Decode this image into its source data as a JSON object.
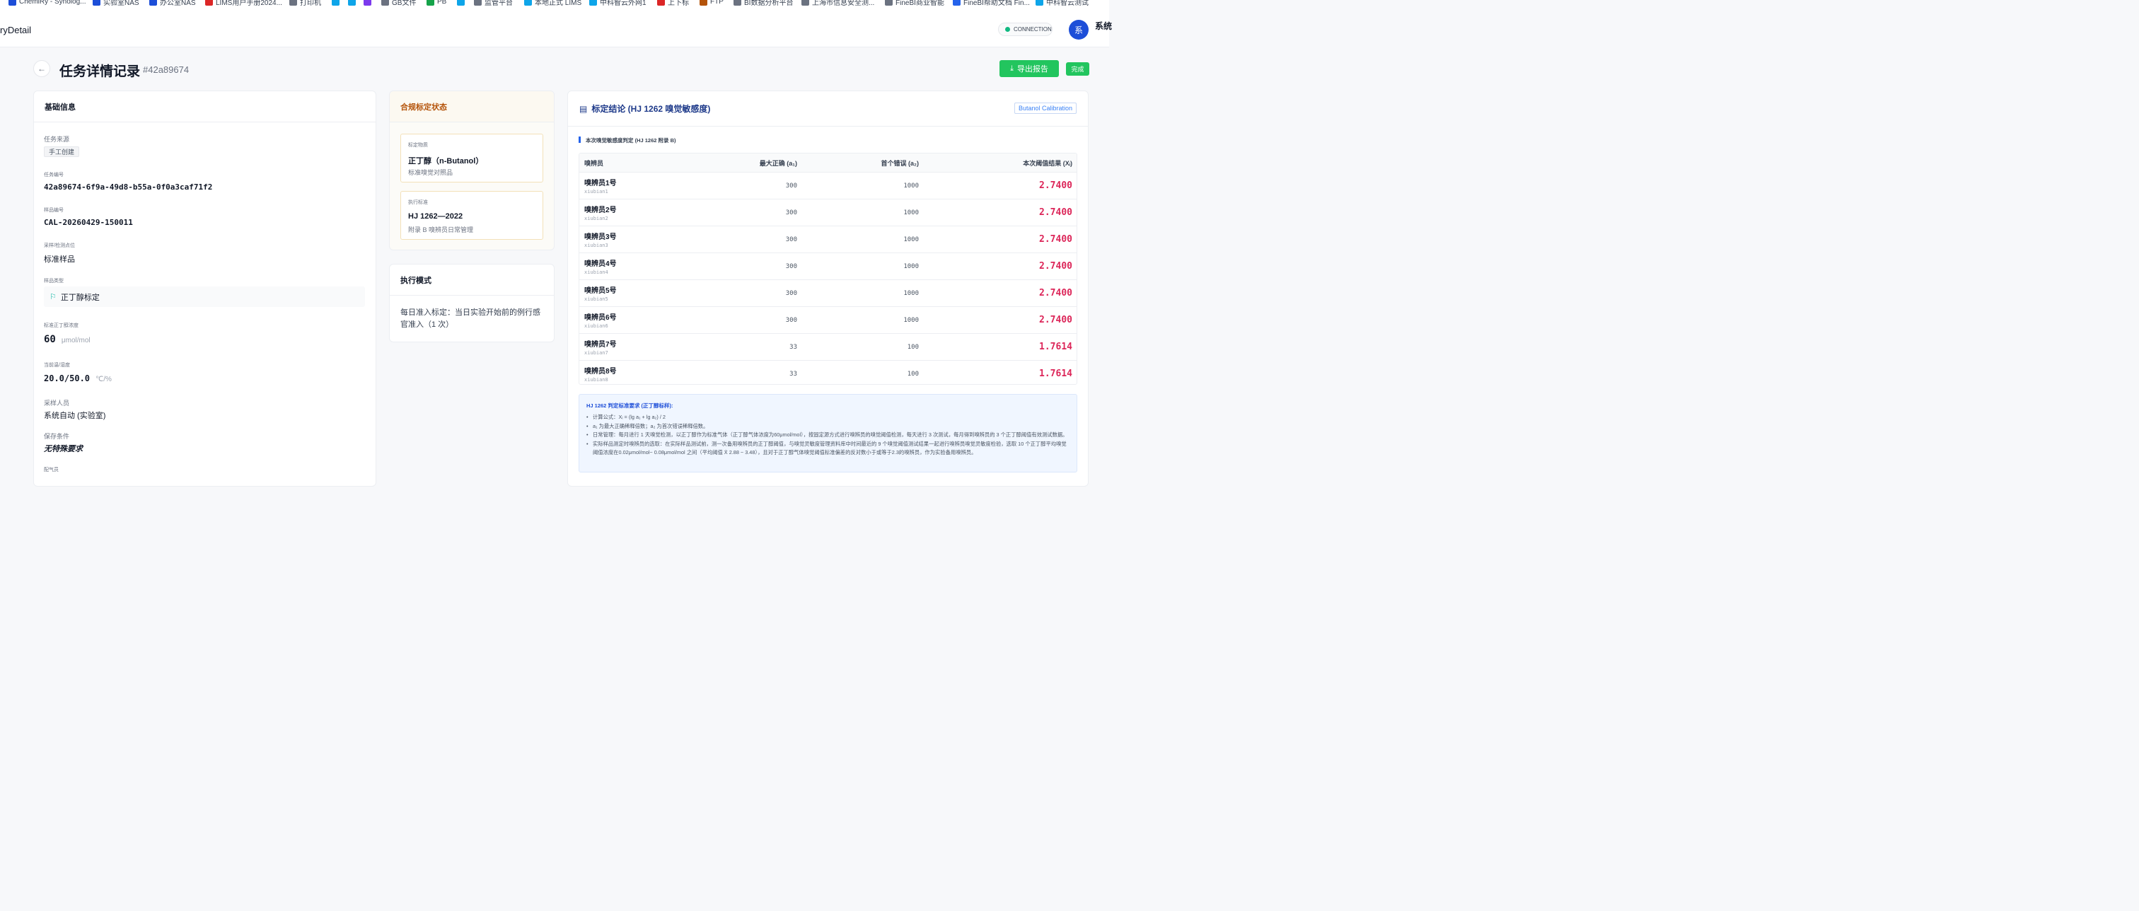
{
  "bookmarks": [
    {
      "label": "ChemiRy - Synolog...",
      "color": "#1d4ed8"
    },
    {
      "label": "实验室NAS",
      "color": "#1d4ed8"
    },
    {
      "label": "办公室NAS",
      "color": "#1d4ed8"
    },
    {
      "label": "LIMS用户手册2024...",
      "color": "#dc2626"
    },
    {
      "label": "打印机",
      "color": "#6b7280"
    },
    {
      "label": "",
      "color": "#0ea5e9"
    },
    {
      "label": "",
      "color": "#0ea5e9"
    },
    {
      "label": "",
      "color": "#7c3aed"
    },
    {
      "label": "GB文件",
      "color": "#6b7280"
    },
    {
      "label": "PB",
      "color": "#16a34a"
    },
    {
      "label": "",
      "color": "#0ea5e9"
    },
    {
      "label": "监管平台",
      "color": "#6b7280"
    },
    {
      "label": "本地正式 LIMS",
      "color": "#0ea5e9"
    },
    {
      "label": "中科智云外网1",
      "color": "#0ea5e9"
    },
    {
      "label": "上下标",
      "color": "#dc2626"
    },
    {
      "label": "FTP",
      "color": "#b45309"
    },
    {
      "label": "BI数据分析平台",
      "color": "#6b7280"
    },
    {
      "label": "上海市信息安全测...",
      "color": "#6b7280"
    },
    {
      "label": "FineBI商业智能",
      "color": "#6b7280"
    },
    {
      "label": "FineBI帮助文档 Fin...",
      "color": "#2563eb"
    },
    {
      "label": "中科智云测试",
      "color": "#0ea5e9"
    }
  ],
  "topbar": {
    "title": "ryDetail",
    "connection": "CONNECTION",
    "avatar": "系",
    "sysname": "系统"
  },
  "page": {
    "title": "任务详情记录",
    "id": "#42a89674",
    "export_label": "导出报告",
    "status": "完成"
  },
  "basic": {
    "header": "基础信息",
    "source_label": "任务来源",
    "source_value": "手工创建",
    "task_no_label": "任务编号",
    "task_no": "42a89674-6f9a-49d8-b55a-0f0a3caf71f2",
    "sample_no_label": "样品编号",
    "sample_no": "CAL-20260429-150011",
    "site_label": "采样/检测点位",
    "site": "标准样品",
    "type_label": "样品类型",
    "type": "正丁醇标定",
    "conc_label": "标准正丁醇浓度",
    "conc": "60",
    "conc_unit": "μmol/mol",
    "env_label": "当前温/湿度",
    "env": "20.0/50.0",
    "env_unit": "℃/%",
    "sampler_label": "采样人员",
    "sampler": "系统自动 (实验室)",
    "storage_label": "保存条件",
    "storage": "无特殊要求",
    "gas_label": "配气员"
  },
  "compliance": {
    "header": "合规标定状态",
    "substance_label": "标定物质",
    "substance": "正丁醇（n-Butanol）",
    "substance_sub": "标准嗅觉对照品",
    "standard_label": "执行标准",
    "standard": "HJ 1262—2022",
    "standard_sub": "附录 B 嗅辨员日常管理"
  },
  "mode": {
    "header": "执行模式",
    "text": "每日准入标定：当日实验开始前的例行感官准入（1 次）"
  },
  "conclusion": {
    "header": "标定结论 (HJ 1262 嗅觉敏感度)",
    "badge": "Butanol Calibration",
    "section": "本次嗅觉敏感度判定 (HJ 1262 附录 B)",
    "columns": [
      "嗅辨员",
      "最大正确 (a₁)",
      "首个错误 (a₂)",
      "本次阈值结果 (Xᵢ)"
    ],
    "rows": [
      {
        "name": "嗅辨员1号",
        "id": "xiubian1",
        "a1": "300",
        "a2": "1000",
        "x": "2.7400"
      },
      {
        "name": "嗅辨员2号",
        "id": "xiubian2",
        "a1": "300",
        "a2": "1000",
        "x": "2.7400"
      },
      {
        "name": "嗅辨员3号",
        "id": "xiubian3",
        "a1": "300",
        "a2": "1000",
        "x": "2.7400"
      },
      {
        "name": "嗅辨员4号",
        "id": "xiubian4",
        "a1": "300",
        "a2": "1000",
        "x": "2.7400"
      },
      {
        "name": "嗅辨员5号",
        "id": "xiubian5",
        "a1": "300",
        "a2": "1000",
        "x": "2.7400"
      },
      {
        "name": "嗅辨员6号",
        "id": "xiubian6",
        "a1": "300",
        "a2": "1000",
        "x": "2.7400"
      },
      {
        "name": "嗅辨员7号",
        "id": "xiubian7",
        "a1": "33",
        "a2": "100",
        "x": "1.7614"
      },
      {
        "name": "嗅辨员8号",
        "id": "xiubian8",
        "a1": "33",
        "a2": "100",
        "x": "1.7614"
      }
    ],
    "note_title": "HJ 1262 判定标准要求 (正丁醇标样):",
    "notes": [
      "计算公式：Xᵢ = (lg a₁ + lg a₂) / 2",
      "a₁ 为最大正确稀释倍数；a₂ 为首次错误稀释倍数。",
      "日常管理：每月进行 1 天嗅觉检测，以正丁醇作为标准气体（正丁醇气体浓度为60μmol/mol），按固定源方式进行嗅辨员的嗅觉阈值检测，每天进行 3 次测试，每月得到嗅辨员的 3 个正丁醇阈值有效测试数据。",
      "实际样品测定时嗅辨员的选取：在实际样品测试前，测一次备用嗅辨员的正丁醇阈值，与嗅觉灵敏度管理资料库中时间最近的 9 个嗅觉阈值测试结果一起进行嗅辨员嗅觉灵敏度检验，选取 10 个正丁醇平均嗅觉阈值浓度在0.02μmol/mol~ 0.08μmol/mol 之间（平均阈值 X̄ 2.88 ~ 3.48），且对于正丁醇气体嗅觉阈值标准偏差的反对数小于或等于2.3的嗅辨员，作为实验备用嗅辨员。"
    ]
  }
}
